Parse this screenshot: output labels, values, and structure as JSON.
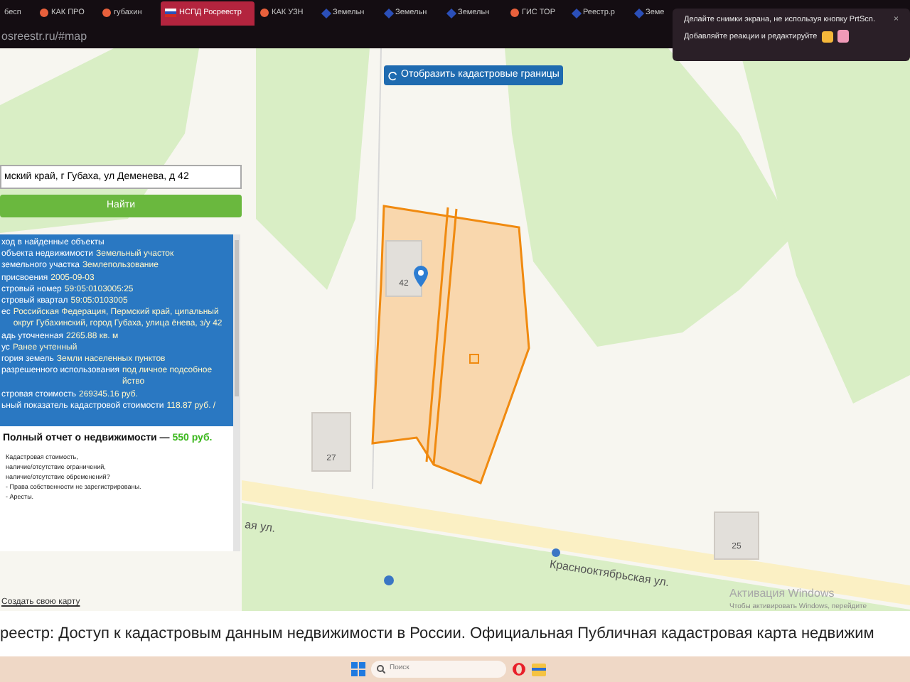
{
  "tabs": [
    {
      "label": "бесп",
      "kind": "plain",
      "selected": false
    },
    {
      "label": "КАК ПРО",
      "kind": "circle",
      "selected": false
    },
    {
      "label": "губахин",
      "kind": "circle",
      "selected": false
    },
    {
      "label": "НСПД Росреестр",
      "kind": "flag",
      "selected": true
    },
    {
      "label": "КАК УЗН",
      "kind": "circle",
      "selected": false
    },
    {
      "label": "Земельн",
      "kind": "shield",
      "selected": false
    },
    {
      "label": "Земельн",
      "kind": "shield",
      "selected": false
    },
    {
      "label": "Земельн",
      "kind": "shield",
      "selected": false
    },
    {
      "label": "ГИС ТОР",
      "kind": "circle",
      "selected": false
    },
    {
      "label": "Реестр.р",
      "kind": "shield",
      "selected": false
    },
    {
      "label": "Земе",
      "kind": "shield",
      "selected": false
    }
  ],
  "address_bar": {
    "url": "osreestr.ru/#map"
  },
  "snip_popup": {
    "line_1": "Делайте снимки экрана, не используя кнопку PrtScn.",
    "line_2": "Добавляйте реакции и редактируйте",
    "close": "×"
  },
  "map": {
    "toggle_button": "Отобразить кадастровые границы",
    "search": {
      "value": "мский край, г Губаха, ул Деменева, д 42",
      "button": "Найти"
    },
    "info": {
      "heading": "ход в найденные объекты",
      "rows": [
        {
          "label": "объекта недвижимости",
          "value": "Земельный участок"
        },
        {
          "label": "земельного участка",
          "value": "Землепользование"
        },
        {
          "label": "присвоения",
          "value": "2005-09-03"
        },
        {
          "label": "стровый номер",
          "value": "59:05:0103005:25"
        },
        {
          "label": "стровый квартал",
          "value": "59:05:0103005"
        },
        {
          "label": "ес",
          "value": "Российская Федерация, Пермский край, ципальный округ Губахинский, город Губаха, улица ёнева, з/у 42"
        },
        {
          "label": "адь уточненная",
          "value": "2265.88 кв. м"
        },
        {
          "label": "ус",
          "value": "Ранее учтенный"
        },
        {
          "label": "гория земель",
          "value": "Земли населенных пунктов"
        },
        {
          "label": "разрешенного использования",
          "value": "под личное подсобное йство"
        },
        {
          "label": "стровая стоимость",
          "value": "269345.16 руб."
        },
        {
          "label": "ьный показатель кадастровой стоимости",
          "value": "118.87 руб. /"
        }
      ]
    },
    "report": {
      "title": "Полный отчет о недвижимости — ",
      "price": "550 руб.",
      "lines": [
        "Кадастровая стоимость,",
        "наличие/отсутствие ограничений,",
        "наличие/отсутствие обременений?",
        "- Права собственности не зарегистрированы.",
        "- Аресты."
      ]
    },
    "create_map_link": "Создать свою карту",
    "house_numbers": [
      "42",
      "27",
      "25"
    ],
    "street_main": "Краснооктябрьская ул.",
    "street_left": "ая ул."
  },
  "windows_activation": {
    "title": "Активация Windows",
    "subtitle": "Чтобы активировать Windows, перейдите"
  },
  "page_text": "реестр: Доступ к кадастровым данным недвижимости в России. Официальная Публичная кадастровая карта недвижим",
  "taskbar": {
    "search_placeholder": "Поиск"
  }
}
